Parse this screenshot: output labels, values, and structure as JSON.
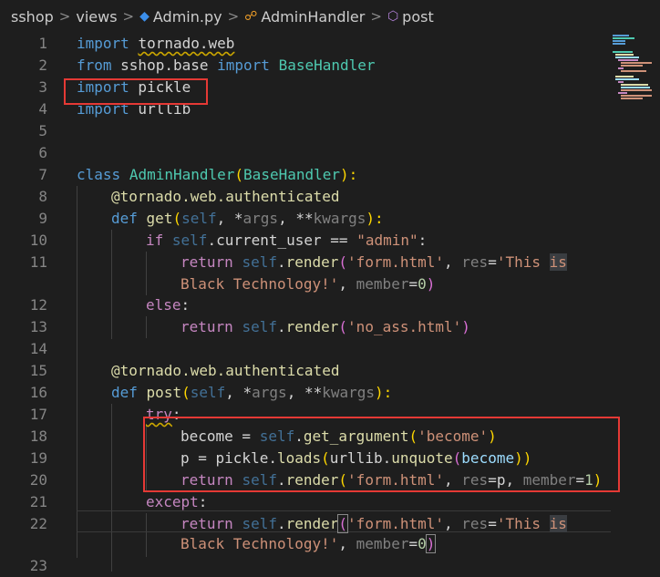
{
  "breadcrumb": {
    "items": [
      "sshop",
      "views",
      "Admin.py",
      "AdminHandler",
      "post"
    ],
    "separator": ">"
  },
  "colors": {
    "keyword": "#569cd6",
    "control": "#c586c0",
    "class": "#4ec9b0",
    "function": "#dcdcaa",
    "string": "#ce9178",
    "number": "#b5cea8",
    "parameter": "#9cdcfe",
    "highlight_box": "#e53935"
  },
  "line_numbers": [
    "1",
    "2",
    "3",
    "4",
    "5",
    "6",
    "7",
    "8",
    "9",
    "10",
    "11",
    "12",
    "13",
    "14",
    "15",
    "16",
    "17",
    "18",
    "19",
    "20",
    "21",
    "22",
    "23"
  ],
  "code": {
    "l1": [
      "import",
      " ",
      "tornado.web"
    ],
    "l2": [
      "from",
      " sshop.base ",
      "import",
      " ",
      "BaseHandler"
    ],
    "l3": [
      "import",
      " pickle"
    ],
    "l4": [
      "import",
      " urllib"
    ],
    "l7": [
      "class",
      " ",
      "AdminHandler",
      "(",
      "BaseHandler",
      "):"
    ],
    "l8": [
      "@tornado.web.authenticated"
    ],
    "l9": [
      "def",
      " ",
      "get",
      "(",
      "self",
      ", *",
      "args",
      ", **",
      "kwargs",
      "):"
    ],
    "l10": [
      "if",
      " ",
      "self",
      ".current_user == ",
      "\"admin\"",
      ":"
    ],
    "l11": [
      "return",
      " ",
      "self",
      ".",
      "render",
      "(",
      "'form.html'",
      ", ",
      "res",
      "=",
      "'This ",
      "is"
    ],
    "l11b": [
      "Black Technology!'",
      ", ",
      "member",
      "=",
      "0",
      ")"
    ],
    "l12": [
      "else",
      ":"
    ],
    "l13": [
      "return",
      " ",
      "self",
      ".",
      "render",
      "(",
      "'no_ass.html'",
      ")"
    ],
    "l15": [
      "@tornado.web.authenticated"
    ],
    "l16": [
      "def",
      " ",
      "post",
      "(",
      "self",
      ", *",
      "args",
      ", **",
      "kwargs",
      "):"
    ],
    "l17": [
      "try",
      ":"
    ],
    "l18": [
      "become = ",
      "self",
      ".",
      "get_argument",
      "(",
      "'become'",
      ")"
    ],
    "l19": [
      "p = pickle.",
      "loads",
      "(",
      "urllib.",
      "unquote",
      "(",
      "become",
      "))"
    ],
    "l20": [
      "return",
      " ",
      "self",
      ".",
      "render",
      "(",
      "'form.html'",
      ", ",
      "res",
      "=p, ",
      "member",
      "=",
      "1",
      ")"
    ],
    "l21": [
      "except",
      ":"
    ],
    "l22": [
      "return",
      " ",
      "self",
      ".",
      "render",
      "(",
      "'form.html'",
      ", ",
      "res",
      "=",
      "'This ",
      "is"
    ],
    "l22b": [
      "Black Technology!'",
      ", ",
      "member",
      "=",
      "0",
      ")"
    ]
  }
}
